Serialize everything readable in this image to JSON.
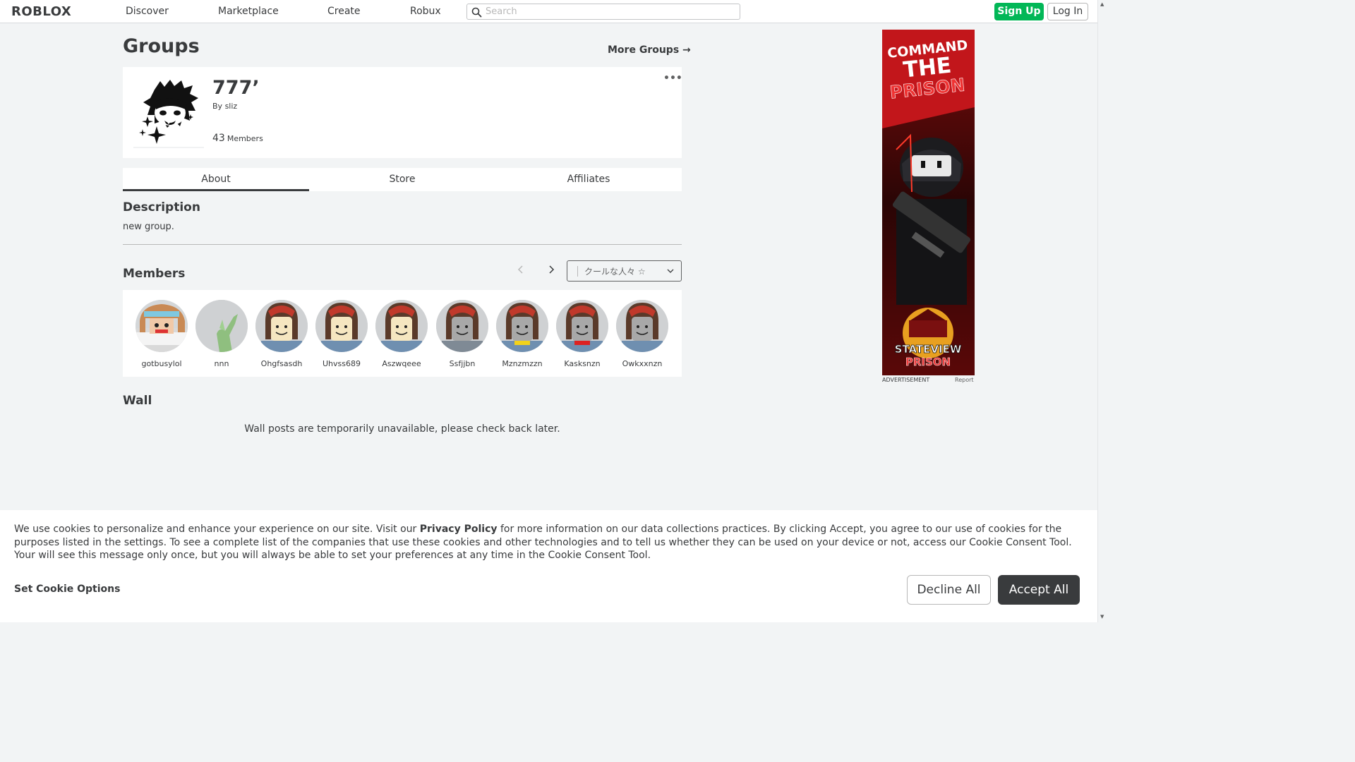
{
  "nav": {
    "logo": "ROBLOX",
    "links": [
      "Discover",
      "Marketplace",
      "Create",
      "Robux"
    ],
    "search_placeholder": "Search",
    "signup": "Sign Up",
    "login": "Log In"
  },
  "page": {
    "title": "Groups",
    "more_groups": "More Groups →"
  },
  "group": {
    "name": "777’",
    "owner_prefix": "By",
    "owner": "sliz",
    "member_count": "43",
    "member_label": "Members",
    "menu": "•••"
  },
  "tabs": [
    "About",
    "Store",
    "Affiliates"
  ],
  "about": {
    "description_title": "Description",
    "description": "new group."
  },
  "members": {
    "title": "Members",
    "role": "クールな人々 ☆",
    "list": [
      {
        "name": "gotbusylol",
        "look": "custom"
      },
      {
        "name": "nnn",
        "look": "default-empty"
      },
      {
        "name": "Ohgfsasdh",
        "look": "noob-blue"
      },
      {
        "name": "Uhvss689",
        "look": "noob-blue"
      },
      {
        "name": "Aszwqeee",
        "look": "noob-blue"
      },
      {
        "name": "Ssfjjbn",
        "look": "noob-gray"
      },
      {
        "name": "Mznzmzzn",
        "look": "noob-yellow"
      },
      {
        "name": "Kasksnzn",
        "look": "noob-red"
      },
      {
        "name": "Owkxxnzn",
        "look": "noob-blue"
      }
    ]
  },
  "wall": {
    "title": "Wall",
    "message": "Wall posts are temporarily unavailable, please check back later."
  },
  "ad": {
    "headline_1": "COMMAND",
    "headline_2": "THE",
    "headline_3": "PRISON",
    "logo_1": "STATEVIEW",
    "logo_2": "PRISON",
    "label": "ADVERTISEMENT",
    "report": "Report"
  },
  "cookie": {
    "text_1": "We use cookies to personalize and enhance your experience on our site. Visit our ",
    "privacy_link": "Privacy Policy",
    "text_2": " for more information on our data collections practices. By clicking Accept, you agree to our use of cookies for the purposes listed in the settings. To see a complete list of the companies that use these cookies and other technologies and to tell us whether they can be used on your device or not, access our Cookie Consent Tool. Your will see this message only once, but you will always be able to set your preferences at any time in the Cookie Consent Tool.",
    "set_options": "Set Cookie Options",
    "decline": "Decline All",
    "accept": "Accept All"
  },
  "colors": {
    "signup_green": "#02b757",
    "background": "#f2f4f5",
    "text": "#393b3d",
    "accept_dark": "#393b3d"
  }
}
